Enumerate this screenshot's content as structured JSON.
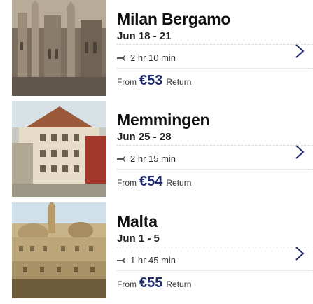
{
  "destinations": [
    {
      "name": "Milan Bergamo",
      "dates": "Jun 18 - 21",
      "duration": "2 hr 10 min",
      "from_label": "From",
      "price": "€53",
      "trip_type": "Return"
    },
    {
      "name": "Memmingen",
      "dates": "Jun 25 - 28",
      "duration": "2 hr 15 min",
      "from_label": "From",
      "price": "€54",
      "trip_type": "Return"
    },
    {
      "name": "Malta",
      "dates": "Jun 1 - 5",
      "duration": "1 hr 45 min",
      "from_label": "From",
      "price": "€55",
      "trip_type": "Return"
    }
  ],
  "icons": {
    "plane": "plane-icon",
    "chevron": "chevron-right-icon"
  },
  "colors": {
    "price": "#1f2a6b",
    "chevron": "#1f2a6b"
  }
}
